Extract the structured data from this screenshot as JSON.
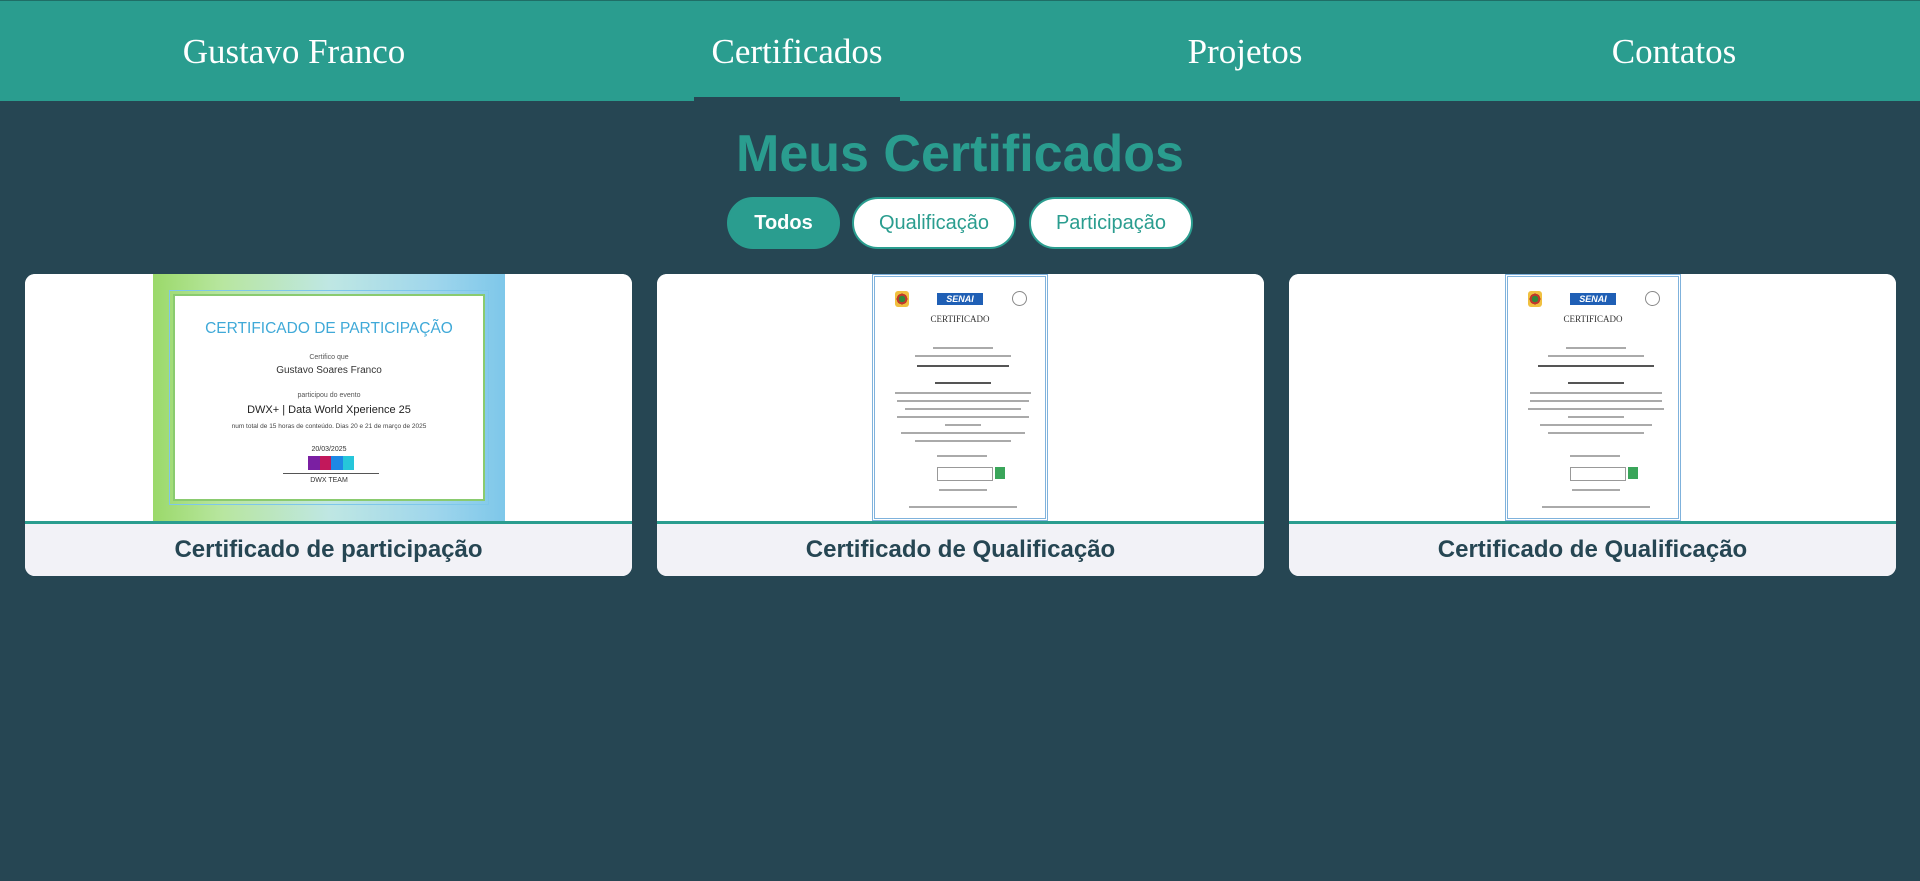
{
  "nav": {
    "brand": "Gustavo Franco",
    "items": [
      "Certificados",
      "Projetos",
      "Contatos"
    ],
    "active": "Certificados"
  },
  "page": {
    "title": "Meus Certificados"
  },
  "filters": [
    "Todos",
    "Qualificação",
    "Participação"
  ],
  "active_filter": "Todos",
  "cards": [
    {
      "caption": "Certificado de participação",
      "image": "participation-certificate"
    },
    {
      "caption": "Certificado de Qualificação",
      "image": "qualification-certificate"
    },
    {
      "caption": "Certificado de Qualificação",
      "image": "qualification-certificate"
    }
  ],
  "participation_certificate": {
    "heading": "CERTIFICADO DE PARTICIPAÇÃO",
    "certify_line": "Certifico que",
    "name": "Gustavo Soares Franco",
    "event_line": "participou do evento",
    "event": "DWX+ | Data World Xperience 25",
    "details": "num total de 15 horas de conteúdo. Dias 20 e 21 de março de 2025",
    "date": "20/03/2025",
    "team": "DWX TEAM"
  },
  "qualification_certificate": {
    "logo": "SENAI",
    "heading": "CERTIFICADO"
  },
  "colors": {
    "nav": "#2a9d8f",
    "background": "#264653",
    "accent": "#2a9d8f",
    "caption_bg": "#f2f2f7"
  }
}
